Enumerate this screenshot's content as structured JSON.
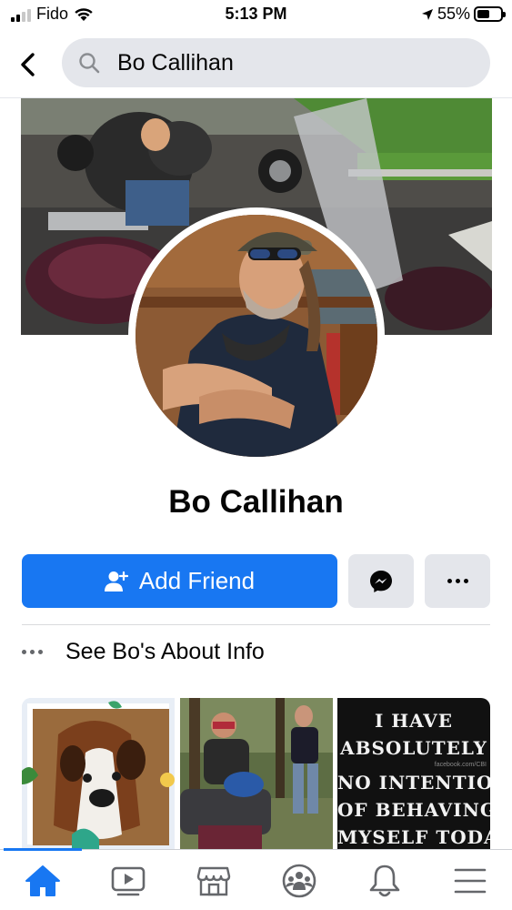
{
  "status_bar": {
    "carrier": "Fido",
    "time": "5:13 PM",
    "battery_percent": "55%",
    "battery_level": 0.55,
    "signal_bars": 2
  },
  "header": {
    "search_text": "Bo Callihan",
    "back_icon": "chevron-left-icon",
    "search_icon": "search-icon"
  },
  "profile": {
    "name": "Bo Callihan"
  },
  "actions": {
    "add_friend_label": "Add Friend",
    "add_friend_icon": "person-add-icon",
    "messenger_icon": "messenger-icon",
    "more_icon": "more-horizontal-icon"
  },
  "about": {
    "label": "See Bo's About Info"
  },
  "photos": {
    "meme_lines": [
      "I HAVE",
      "ABSOLUTELY",
      "NO INTENTION",
      "OF BEHAVING",
      "MYSELF TODAY"
    ],
    "meme_watermark": "facebook.com/CBI"
  },
  "tabbar": {
    "tabs": [
      {
        "name": "home",
        "icon": "home-icon",
        "active": true
      },
      {
        "name": "watch",
        "icon": "video-icon",
        "active": false
      },
      {
        "name": "marketplace",
        "icon": "marketplace-icon",
        "active": false
      },
      {
        "name": "groups",
        "icon": "groups-icon",
        "active": false
      },
      {
        "name": "notifications",
        "icon": "bell-icon",
        "active": false
      },
      {
        "name": "menu",
        "icon": "hamburger-menu-icon",
        "active": false
      }
    ]
  },
  "colors": {
    "brand_blue": "#1877f2",
    "button_gray": "#e4e6eb",
    "text_primary": "#050505",
    "text_secondary": "#65676b"
  }
}
